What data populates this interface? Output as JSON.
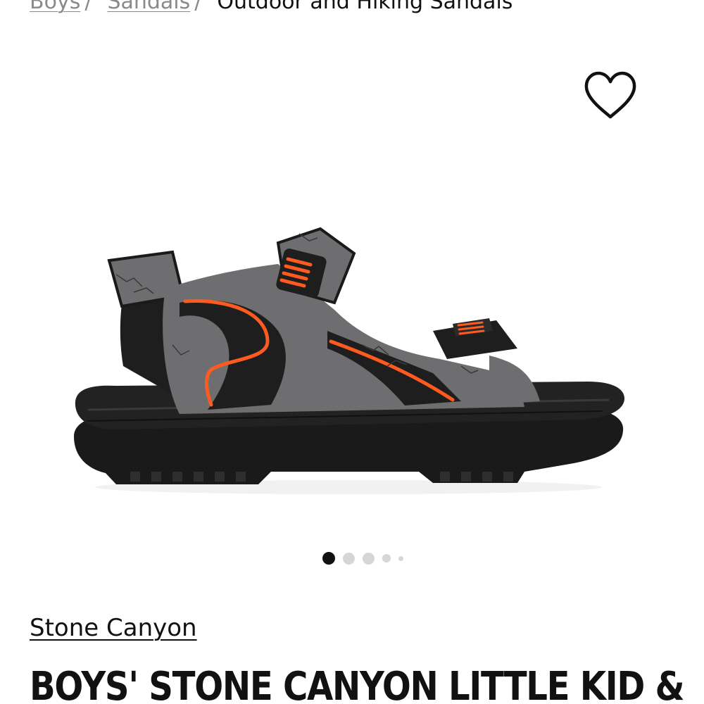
{
  "breadcrumb": {
    "items": [
      {
        "label": "Boys",
        "separator": "/"
      },
      {
        "label": "Sandals",
        "separator": "/"
      }
    ],
    "current": "Outdoor and Hiking Sandals"
  },
  "favorite": {
    "icon": "heart-outline-icon"
  },
  "product_image": {
    "icon": "sandal-product-photo",
    "colors": {
      "upper": "#6e6e70",
      "trim": "#1c1c1c",
      "accent": "#ff5a1f",
      "sole": "#1a1a1a"
    }
  },
  "carousel": {
    "total_dots": 5,
    "active_index": 0
  },
  "product": {
    "brand": "Stone Canyon",
    "title": "BOYS' STONE CANYON LITTLE KID &"
  },
  "colors": {
    "text": "#111111",
    "muted": "#8a8a8a",
    "dot_inactive": "#d6d6d6",
    "dot_active": "#111111"
  }
}
